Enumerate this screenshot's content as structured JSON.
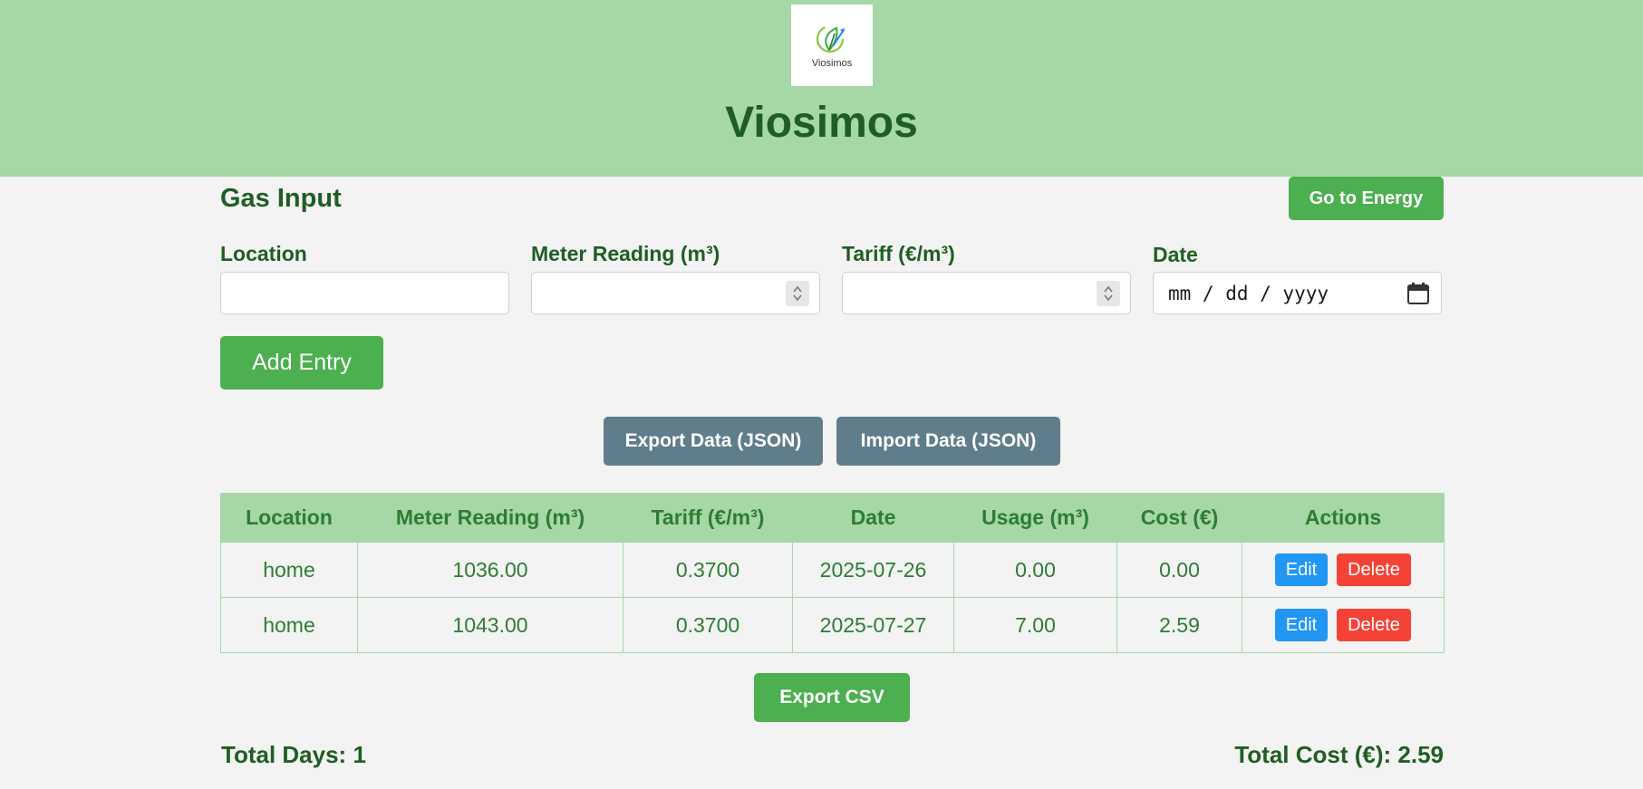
{
  "header": {
    "logo_text": "Viosimos",
    "title": "Viosimos",
    "background_color": "#a5d7a7"
  },
  "section": {
    "title": "Gas Input",
    "go_energy_label": "Go to Energy"
  },
  "form": {
    "location": {
      "label": "Location",
      "value": ""
    },
    "meter_reading": {
      "label": "Meter Reading (m³)",
      "value": ""
    },
    "tariff": {
      "label": "Tariff (€/m³)",
      "value": ""
    },
    "date": {
      "label": "Date",
      "placeholder": "mm / dd / yyyy"
    },
    "add_entry_label": "Add Entry"
  },
  "data_actions": {
    "export_json_label": "Export Data (JSON)",
    "import_json_label": "Import Data (JSON)"
  },
  "table": {
    "headers": [
      "Location",
      "Meter Reading (m³)",
      "Tariff (€/m³)",
      "Date",
      "Usage (m³)",
      "Cost (€)",
      "Actions"
    ],
    "rows": [
      {
        "location": "home",
        "meter_reading": "1036.00",
        "tariff": "0.3700",
        "date": "2025-07-26",
        "usage": "0.00",
        "cost": "0.00"
      },
      {
        "location": "home",
        "meter_reading": "1043.00",
        "tariff": "0.3700",
        "date": "2025-07-27",
        "usage": "7.00",
        "cost": "2.59"
      }
    ],
    "edit_label": "Edit",
    "delete_label": "Delete"
  },
  "export_csv_label": "Export CSV",
  "totals": {
    "days": "Total Days: 1",
    "cost": "Total Cost (€): 2.59"
  },
  "colors": {
    "primary_green": "#4caf50",
    "slate": "#607d8b",
    "edit_blue": "#2196f3",
    "delete_red": "#f44336",
    "text_green": "#1e5e22"
  },
  "icons": [
    "leaf-logo-icon",
    "spinner-arrows-icon",
    "calendar-icon"
  ]
}
